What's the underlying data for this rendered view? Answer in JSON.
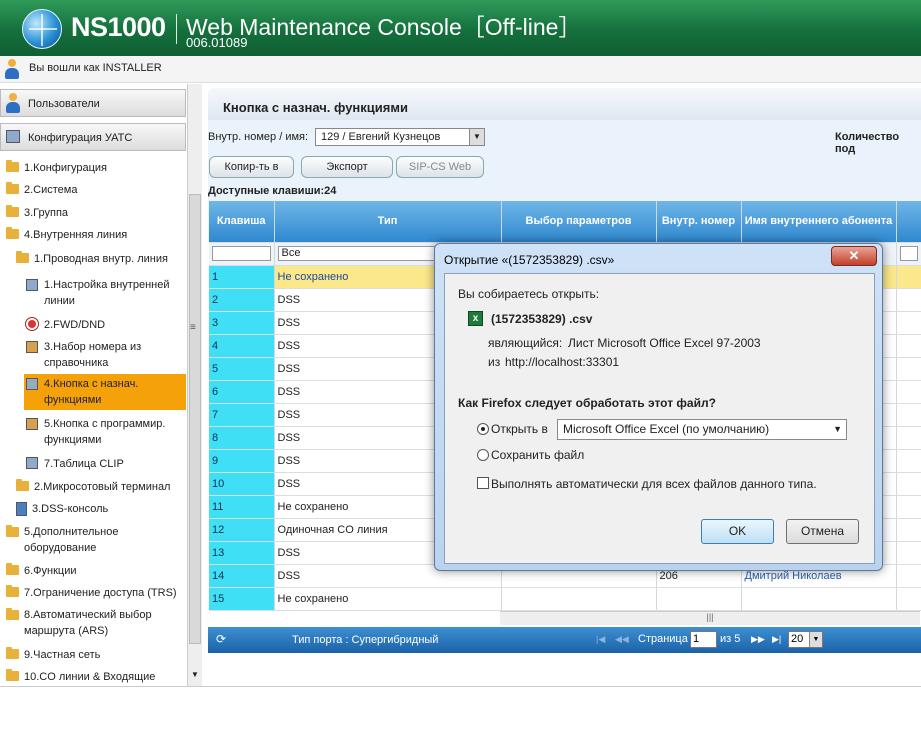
{
  "header": {
    "model": "NS1000",
    "title": "Web Maintenance Console［Off-line］",
    "version": "006.01089"
  },
  "userbar": {
    "label": "Вы вошли как INSTALLER"
  },
  "sidebar": {
    "users": "Пользователи",
    "pbx_config": "Конфигурация УАТС",
    "items": [
      "1.Конфигурация",
      "2.Система",
      "3.Группа",
      "4.Внутренняя линия",
      "1.Проводная внутр. линия",
      "1.Настройка внутренней линии",
      "2.FWD/DND",
      "3.Набор номера из справочника",
      "4.Кнопка с назнач. функциями",
      "5.Кнопка с программир. функциями",
      "7.Таблица CLIP",
      "2.Микросотовый терминал",
      "3.DSS-консоль",
      "5.Дополнительное оборудование",
      "6.Функции",
      "7.Ограничение доступа (TRS)",
      "8.Автоматический выбор маршрута (ARS)",
      "9.Частная сеть",
      "10.CO линии & Входящие"
    ]
  },
  "main": {
    "page_title": "Кнопка с назнач. функциями",
    "ext_label": "Внутр. номер / имя:",
    "ext_value": "129 / Евгений Кузнецов",
    "count_label": "Количество под",
    "btn_copy": "Копир-ть в",
    "btn_export": "Экспорт",
    "btn_sipcs": "SIP-CS Web",
    "avail_keys": "Доступные клавиши:24"
  },
  "grid": {
    "headers": [
      "Клавиша",
      "Тип",
      "Выбор параметров",
      "Внутр. номер",
      "Имя внутреннего абонента"
    ],
    "filter_type": "Все",
    "rows": [
      {
        "key": "1",
        "type": "Не сохранено",
        "ext": "",
        "name": ""
      },
      {
        "key": "2",
        "type": "DSS",
        "ext": "",
        "name": ""
      },
      {
        "key": "3",
        "type": "DSS",
        "ext": "",
        "name": ""
      },
      {
        "key": "4",
        "type": "DSS",
        "ext": "",
        "name": ""
      },
      {
        "key": "5",
        "type": "DSS",
        "ext": "",
        "name": ""
      },
      {
        "key": "6",
        "type": "DSS",
        "ext": "",
        "name": ""
      },
      {
        "key": "7",
        "type": "DSS",
        "ext": "",
        "name": ""
      },
      {
        "key": "8",
        "type": "DSS",
        "ext": "",
        "name": ""
      },
      {
        "key": "9",
        "type": "DSS",
        "ext": "",
        "name": ""
      },
      {
        "key": "10",
        "type": "DSS",
        "ext": "",
        "name": ""
      },
      {
        "key": "11",
        "type": "Не сохранено",
        "ext": "",
        "name": ""
      },
      {
        "key": "12",
        "type": "Одиночная CO линия",
        "ext": "",
        "name": ""
      },
      {
        "key": "13",
        "type": "DSS",
        "ext": "",
        "name": ""
      },
      {
        "key": "14",
        "type": "DSS",
        "ext": "206",
        "name": "Дмитрий Николаев"
      },
      {
        "key": "15",
        "type": "Не сохранено",
        "ext": "",
        "name": ""
      }
    ]
  },
  "footer": {
    "port_type": "Тип порта : Супергибридный",
    "page_label": "Страница",
    "page": "1",
    "of": "из 5",
    "per_page": "20"
  },
  "dialog": {
    "title": "Открытие «(1572353829) .csv»",
    "intro": "Вы собираетесь открыть:",
    "filename": "(1572353829) .csv",
    "type_label": "являющийся:",
    "type_value": "Лист Microsoft Office Excel 97-2003",
    "from_label": "из",
    "from_value": "http://localhost:33301",
    "question": "Как Firefox следует обработать этот файл?",
    "open_with": "Открыть в",
    "app": "Microsoft Office Excel (по умолчанию)",
    "save": "Сохранить файл",
    "auto": "Выполнять автоматически для всех файлов данного типа.",
    "ok": "OK",
    "cancel": "Отмена",
    "close": "✕"
  },
  "colors": {
    "header_green": "#14703c",
    "grid_header": "#2f88cf",
    "key_cyan": "#3fe0f5",
    "selected": "#f5a20a"
  }
}
